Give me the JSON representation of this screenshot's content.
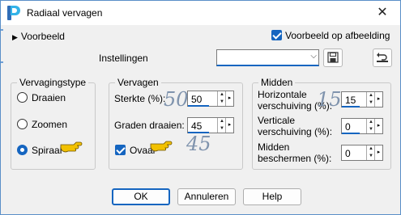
{
  "window": {
    "title": "Radiaal vervagen",
    "close": "✕"
  },
  "preview": {
    "toggle_label": "Voorbeeld",
    "checkbox_label": "Voorbeeld op afbeelding",
    "checkbox_checked": true
  },
  "settings": {
    "label": "Instellingen",
    "select_value": ""
  },
  "blur_type": {
    "title": "Vervagingstype",
    "options": [
      {
        "label": "Draaien",
        "selected": false
      },
      {
        "label": "Zoomen",
        "selected": false
      },
      {
        "label": "Spiraal",
        "selected": true
      }
    ]
  },
  "blur": {
    "title": "Vervagen",
    "strength_label": "Sterkte (%):",
    "strength_value": "50",
    "angle_label": "Graden draaien:",
    "angle_value": "45",
    "oval_label": "Ovaal",
    "oval_checked": true
  },
  "center": {
    "title": "Midden",
    "h_label_1": "Horizontale",
    "h_label_2": "verschuiving (%):",
    "h_value": "15",
    "v_label_1": "Verticale",
    "v_label_2": "verschuiving (%):",
    "v_value": "0",
    "m_label_1": "Midden",
    "m_label_2": "beschermen (%):",
    "m_value": "0"
  },
  "annotations": {
    "strength": "50",
    "angle": "45",
    "horizontal": "15"
  },
  "buttons": {
    "ok": "OK",
    "cancel": "Annuleren",
    "help": "Help"
  },
  "colors": {
    "accent": "#1565c0",
    "window_border": "#5a8fc8",
    "annotation": "#7f93ad",
    "hand": "#f2c100"
  }
}
